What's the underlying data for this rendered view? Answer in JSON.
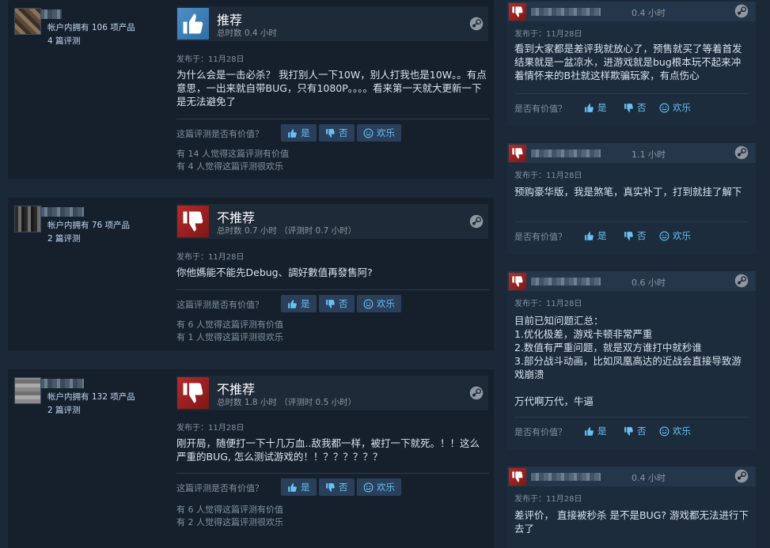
{
  "left_reviews": [
    {
      "author_products": "帐户内拥有 106 项产品",
      "author_reviews": "4 篇评测",
      "vote": "推荐",
      "hours": "总时数 0.4 小时",
      "posted": "发布于：11月28日",
      "text": "为什么会是一击必杀？ 我打别人一下10W，别人打我也是10W。。有点意思，一出来就自带BUG，只有1080P。。。。看来第一天就大更新一下 是无法避免了",
      "helpful_question": "这篇评测是否有价值？",
      "btn_yes": "是",
      "btn_no": "否",
      "btn_funny": "欢乐",
      "helpful_count": "有 14 人觉得这篇评测有价值",
      "funny_count": "有 4 人觉得这篇评测很欢乐"
    },
    {
      "author_products": "帐户内拥有 76 项产品",
      "author_reviews": "2 篇评测",
      "vote": "不推荐",
      "hours": "总时数 0.7 小时 （评测时 0.7 小时）",
      "posted": "发布于：11月28日",
      "text": "你他媽能不能先Debug、調好數值再發售阿?",
      "helpful_question": "这篇评测是否有价值？",
      "btn_yes": "是",
      "btn_no": "否",
      "btn_funny": "欢乐",
      "helpful_count": "有 6 人觉得这篇评测有价值",
      "funny_count": "有 1 人觉得这篇评测很欢乐"
    },
    {
      "author_products": "帐户内拥有 132 项产品",
      "author_reviews": "2 篇评测",
      "vote": "不推荐",
      "hours": "总时数 1.8 小时 （评测时 0.5 小时）",
      "posted": "发布于：11月28日",
      "text": "刚开局，随便打一下十几万血..敌我都一样，被打一下就死。！！这么严重的BUG, 怎么测试游戏的！！？？？？？？",
      "helpful_question": "这篇评测是否有价值？",
      "btn_yes": "是",
      "btn_no": "否",
      "btn_funny": "欢乐",
      "helpful_count": "有 6 人觉得这篇评测有价值",
      "funny_count": "有 2 人觉得这篇评测很欢乐"
    }
  ],
  "right_reviews": [
    {
      "hours": "0.4 小时",
      "posted": "发布于：11月28日",
      "text": "看到大家都是差评我就放心了，预售就买了等着首发结果就是一盆凉水，进游戏就是bug根本玩不起来冲着情怀来的B社就这样欺骗玩家，有点伤心",
      "helpful_question": "是否有价值？",
      "btn_yes": "是",
      "btn_no": "否",
      "btn_funny": "欢乐"
    },
    {
      "hours": "1.1 小时",
      "posted": "发布于：11月28日",
      "text": "预购豪华版，我是煞笔，真实补丁，打到就挂了解下",
      "helpful_question": "是否有价值？",
      "btn_yes": "是",
      "btn_no": "否",
      "btn_funny": "欢乐"
    },
    {
      "hours": "0.6 小时",
      "posted": "发布于：11月28日",
      "text_lines": [
        "目前已知问题汇总：",
        "1.优化极差，游戏卡顿非常严重",
        "2.数值有严重问题，就是双方谁打中就秒谁",
        "3.部分战斗动画，比如凤凰高达的近战会直接导致游戏崩溃",
        "",
        "万代啊万代，牛逼"
      ],
      "helpful_question": "是否有价值？",
      "btn_yes": "是",
      "btn_no": "否",
      "btn_funny": "欢乐"
    },
    {
      "hours": "0.4 小时",
      "posted": "发布于：11月28日",
      "text": "差评价， 直接被秒杀 是不是BUG? 游戏都无法进行下去了"
    }
  ],
  "colors": {
    "background": "#1b2838",
    "card": "#16202d",
    "thumb_up": "#4e8fc6",
    "thumb_down": "#b52a2a",
    "link": "#67c1f5"
  },
  "icons": [
    "thumbs-up-icon",
    "thumbs-down-icon",
    "steam-logo-icon",
    "smiley-icon"
  ]
}
